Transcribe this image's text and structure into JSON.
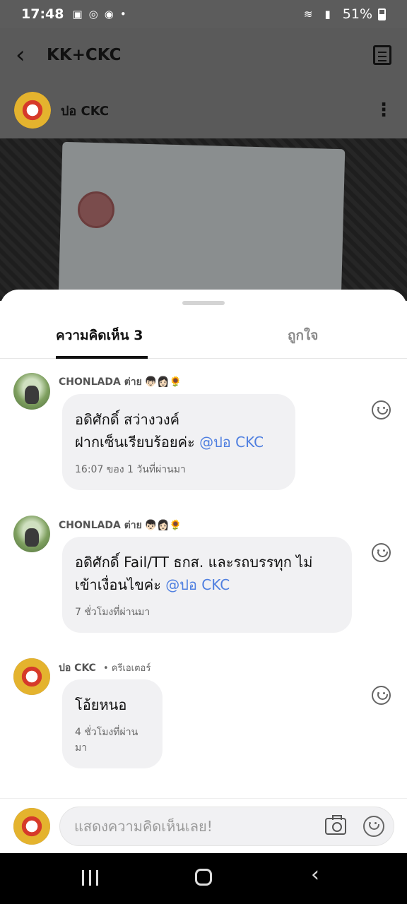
{
  "status_bar": {
    "time": "17:48",
    "battery": "51%"
  },
  "app_bar": {
    "title": "KK+CKC"
  },
  "post_header": {
    "name": "ปอ CKC"
  },
  "tabs": {
    "comments": "ความคิดเห็น 3",
    "likes": "ถูกใจ"
  },
  "comments": [
    {
      "name": "CHONLADA ต่าย",
      "emoji": "👦🏻👩🏻🌻",
      "text": "อดิศักดิ์ สว่างวงค์\nฝากเซ็นเรียบร้อยค่ะ ",
      "mention": "@ปอ CKC",
      "time": "16:07 ของ 1 วันที่ผ่านมา"
    },
    {
      "name": "CHONLADA ต่าย",
      "emoji": "👦🏻👩🏻🌻",
      "text": "อดิศักดิ์ Fail/TT ธกส. และรถบรรทุก ไม่\nเข้าเงื่อนไขค่ะ ",
      "mention": "@ปอ CKC",
      "time": "7 ชั่วโมงที่ผ่านมา"
    },
    {
      "name": "ปอ CKC",
      "role": "• ครีเอเตอร์",
      "text": "โอ้ยหนอ",
      "time": "4 ชั่วโมงที่ผ่านมา"
    }
  ],
  "composer": {
    "placeholder": "แสดงความคิดเห็นเลย!"
  },
  "icons": [
    "back-arrow-icon",
    "note-icon",
    "kebab-icon",
    "smile-icon",
    "camera-icon",
    "recent-apps-icon",
    "home-icon",
    "nav-back-icon"
  ]
}
